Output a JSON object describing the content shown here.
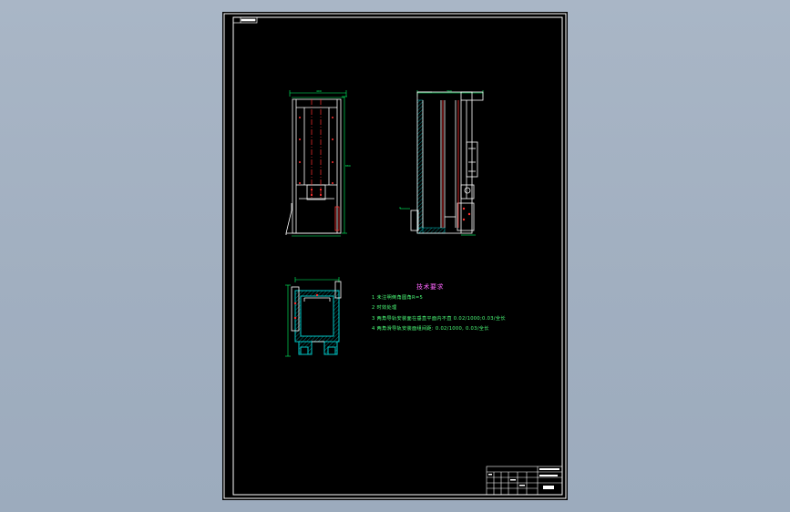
{
  "technical_requirements": {
    "title": "技术要求",
    "items": [
      "1  未注明倒角圆角R=5",
      "2  时效处理",
      "3  两角导轨安装面在垂直平面内不直 0.02/1000;0.03/全长",
      "4  两角滑导轨安装面组间距: 0.02/1000, 0.03/全长"
    ]
  },
  "colors": {
    "background": "#a5b2c3",
    "sheet": "#000000",
    "frame": "#ffffff",
    "drawing_lines": "#ffffff",
    "dimension_lines": "#00ff66",
    "hatch": "#00c8c8",
    "centerlines": "#ff3030",
    "text": "#4cff7a"
  }
}
